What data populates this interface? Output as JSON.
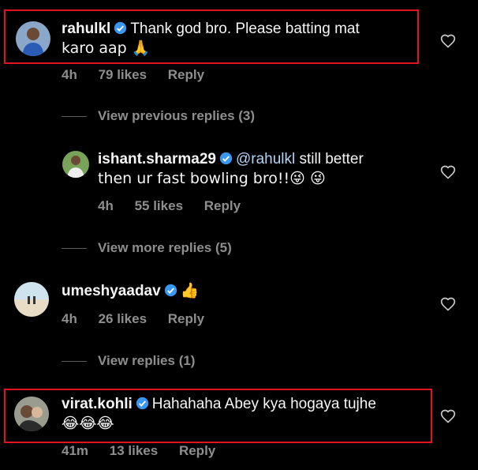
{
  "comments": [
    {
      "username": "rahulkl",
      "text_line1": "Thank god bro. Please batting mat",
      "text_line2": "karo aap 🙏",
      "time": "4h",
      "likes": "79 likes",
      "reply_label": "Reply"
    },
    {
      "username": "ishant.sharma29",
      "mention": "@rahulkl",
      "text_line1": " still better",
      "text_line2": "then ur fast bowling bro!!😜 😜",
      "time": "4h",
      "likes": "55 likes",
      "reply_label": "Reply"
    },
    {
      "username": "umeshyaadav",
      "text_line1": "👍",
      "time": "4h",
      "likes": "26 likes",
      "reply_label": "Reply"
    },
    {
      "username": "virat.kohli",
      "text_line1": "Hahahaha Abey kya hogaya tujhe",
      "text_line2": "😂😂😂",
      "time": "41m",
      "likes": "13 likes",
      "reply_label": "Reply"
    }
  ],
  "reply_toggles": {
    "previous": "View previous replies (3)",
    "more": "View more replies (5)",
    "replies": "View replies (1)"
  },
  "colors": {
    "background": "#000000",
    "text": "#f5f5f5",
    "muted": "#8e8e8e",
    "verified": "#3897f0",
    "highlight": "#e0141e"
  }
}
